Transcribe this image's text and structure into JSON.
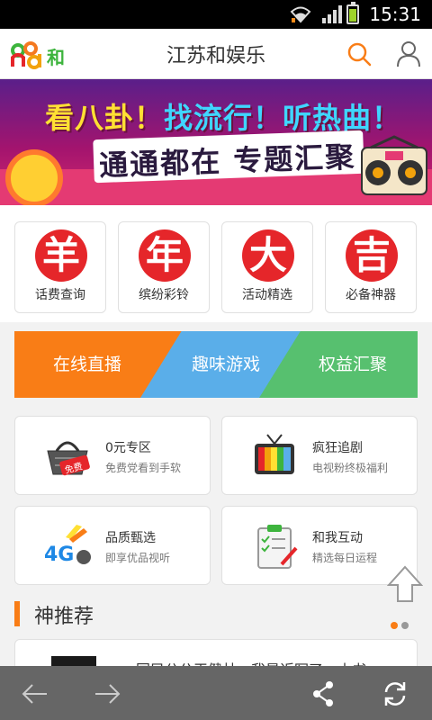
{
  "status_bar": {
    "time": "15:31"
  },
  "header": {
    "title": "江苏和娱乐",
    "logo_icon": "and-logo-icon",
    "logo_suffix": "和"
  },
  "banner": {
    "line1_parts": [
      "看八卦！",
      "找流行！",
      "听热曲！"
    ],
    "line2": "通通都在 专题汇聚"
  },
  "icon_row": [
    {
      "glyph": "羊",
      "label": "话费查询"
    },
    {
      "glyph": "年",
      "label": "缤纷彩铃"
    },
    {
      "glyph": "大",
      "label": "活动精选"
    },
    {
      "glyph": "吉",
      "label": "必备神器"
    }
  ],
  "tabs": [
    {
      "label": "在线直播",
      "color": "#f97d16"
    },
    {
      "label": "趣味游戏",
      "color": "#5aaee9"
    },
    {
      "label": "权益汇聚",
      "color": "#57c06f"
    }
  ],
  "grid": [
    {
      "title": "0元专区",
      "subtitle": "免费党看到手软",
      "icon": "free-basket-icon",
      "badge": "免费"
    },
    {
      "title": "疯狂追剧",
      "subtitle": "电视粉终极福利",
      "icon": "tv-icon"
    },
    {
      "title": "品质甄选",
      "subtitle": "即享优品视听",
      "icon": "4g-icon",
      "badge": "4G"
    },
    {
      "title": "和我互动",
      "subtitle": "精选每日运程",
      "icon": "clipboard-icon"
    }
  ],
  "section": {
    "title": "神推荐"
  },
  "preview": {
    "text": "国民公公王健林：我是近写了一本书"
  },
  "pager": {
    "active_color": "#f97d16",
    "inactive_color": "#999999"
  }
}
